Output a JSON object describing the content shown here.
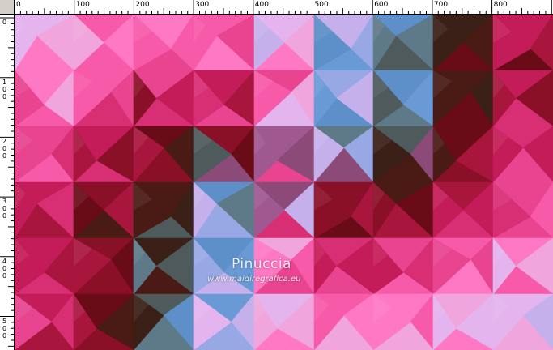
{
  "ruler": {
    "horizontal_labels": [
      "0",
      "100",
      "200",
      "300",
      "400",
      "500",
      "600",
      "700",
      "800"
    ],
    "vertical_labels": [
      "0",
      "100",
      "200",
      "300",
      "400",
      "500"
    ]
  },
  "watermark": {
    "name": "Pinuccia",
    "url": "www.maidiregrafica.eu"
  },
  "colors": {
    "ruler_bg": "#ffffff",
    "ruler_text": "#000000",
    "canvas_border": "#000000",
    "hot_pink": "#f05aa8",
    "magenta_deep": "#c81e5a",
    "dark_maroon": "#4a1010",
    "steel_blue": "#5d8fc8",
    "lavender": "#e6b4ee"
  }
}
